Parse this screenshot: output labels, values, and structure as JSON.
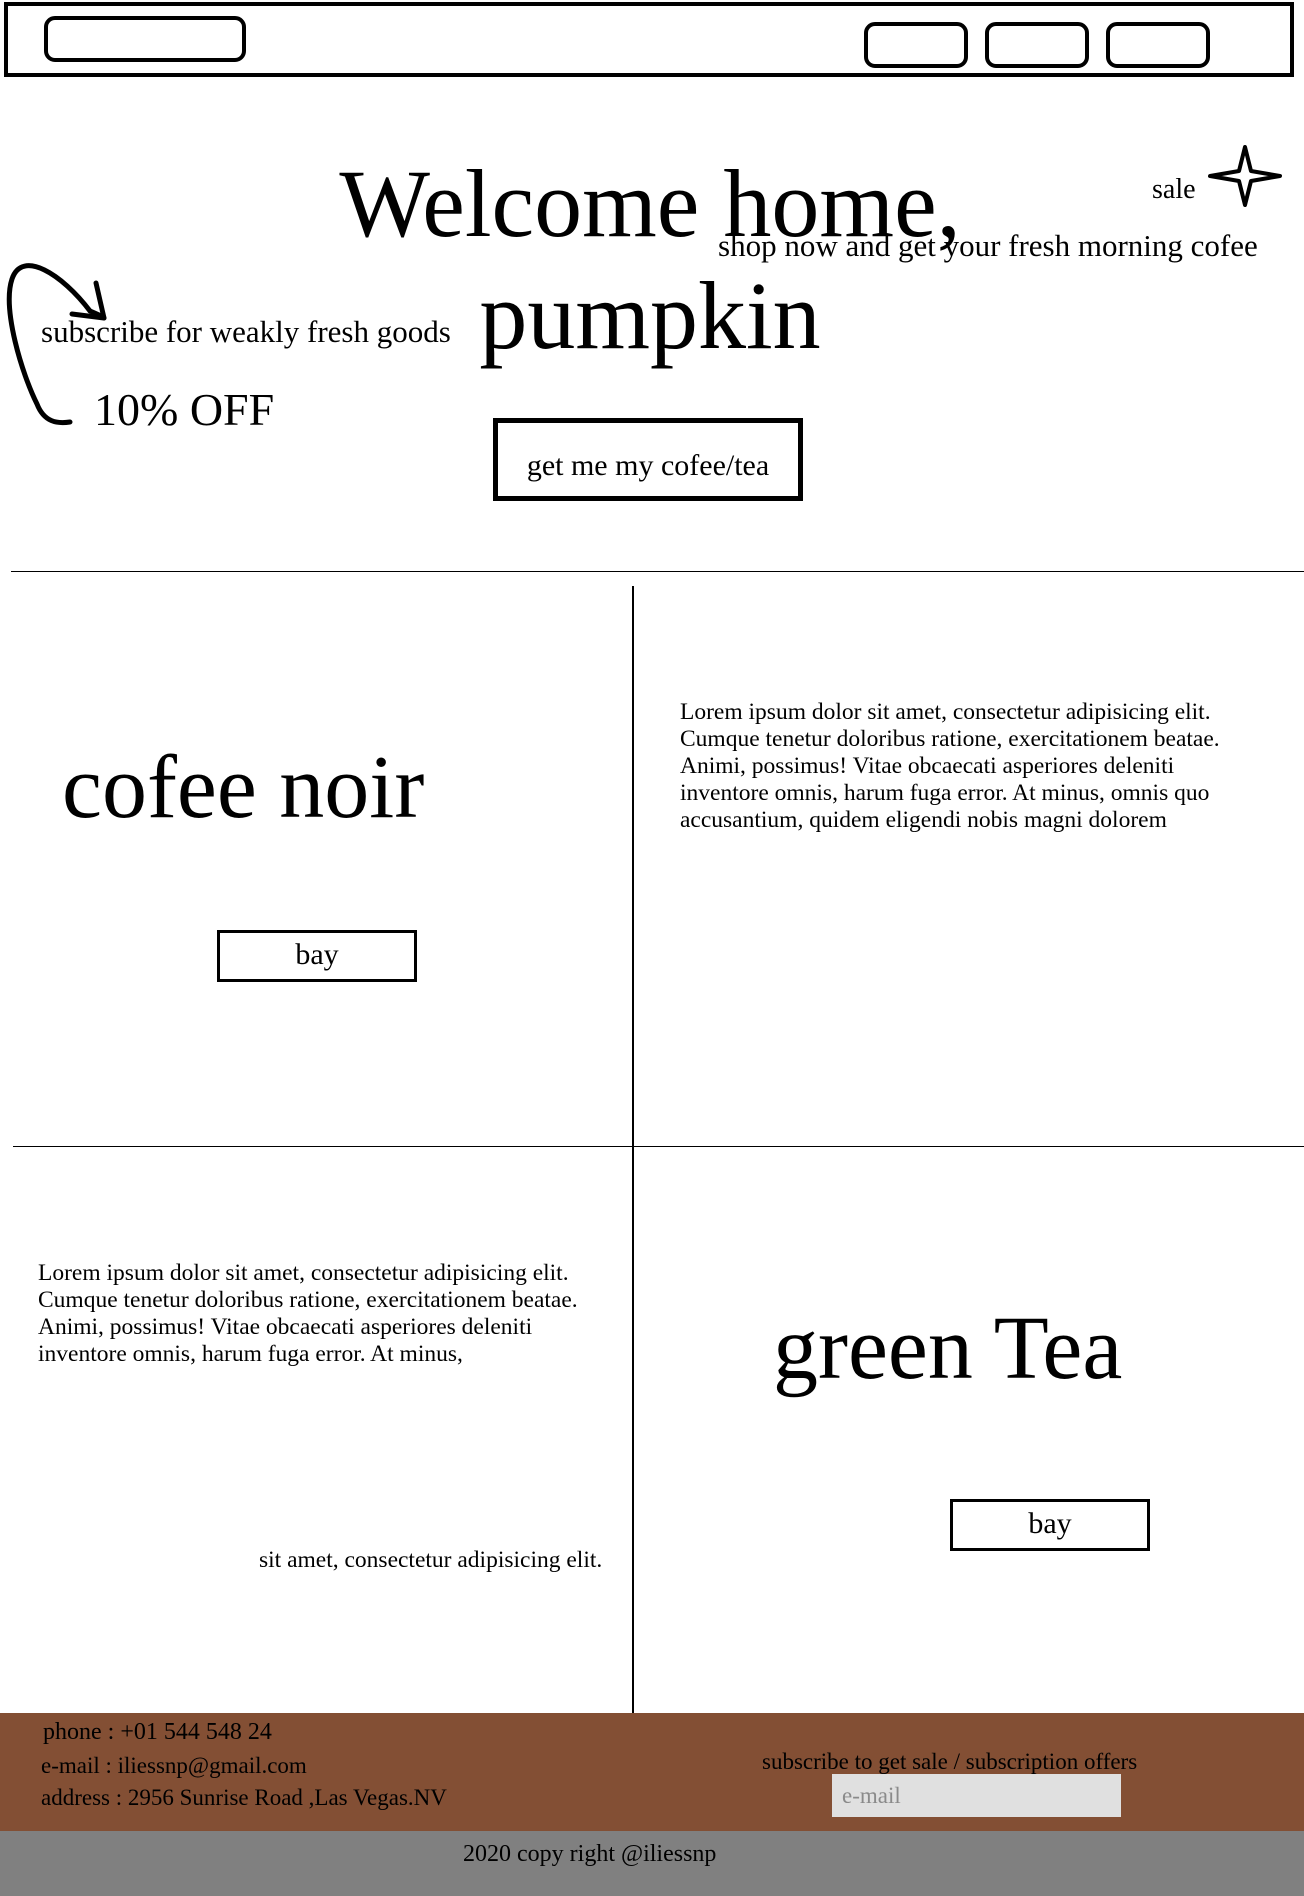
{
  "nav": {
    "logo_placeholder": "",
    "links": [
      "",
      "",
      ""
    ]
  },
  "hero": {
    "title_line1": "Welcome home,",
    "title_line2": "pumpkin",
    "tagline": "shop now and get your fresh morning cofee",
    "sale_label": "sale",
    "subscribe_note": "subscribe for weakly fresh goods",
    "discount": "10% OFF",
    "cta_label": "get me my cofee/tea"
  },
  "products": [
    {
      "name": "cofee noir",
      "buy_label": "bay",
      "description": "Lorem ipsum dolor sit amet, consectetur adipisicing elit. Cumque tenetur doloribus ratione, exercitationem beatae. Animi, possimus! Vitae obcaecati asperiores deleniti inventore omnis, harum fuga error. At minus, omnis quo accusantium, quidem eligendi nobis magni dolorem"
    },
    {
      "name": "green Tea",
      "buy_label": "bay",
      "description": "Lorem ipsum dolor sit amet, consectetur adipisicing elit. Cumque tenetur doloribus ratione, exercitationem beatae. Animi, possimus! Vitae obcaecati asperiores deleniti inventore omnis, harum fuga error. At minus,",
      "description_tail": "sit amet, consectetur adipisicing elit."
    }
  ],
  "footer": {
    "phone": "phone : +01 544 548 24",
    "email": "e-mail : iliessnp@gmail.com",
    "address": "address : 2956  Sunrise Road ,Las Vegas.NV",
    "subscribe_text": "subscribe to get sale / subscription offers",
    "email_placeholder": "e-mail",
    "copyright": "2020 copy right @iliessnp"
  },
  "colors": {
    "footer_bg": "#834F34",
    "bottom_bar_bg": "#808080",
    "input_bg": "#e0e0e0"
  },
  "icons": [
    "star-icon",
    "curved-arrow-icon"
  ]
}
